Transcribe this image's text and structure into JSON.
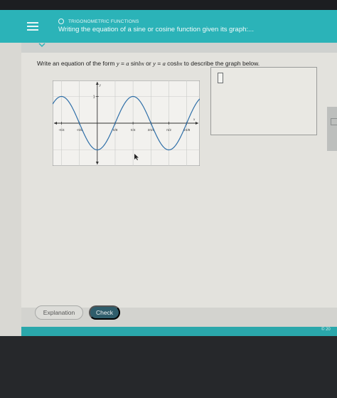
{
  "header": {
    "topic": "TRIGONOMETRIC FUNCTIONS",
    "title": "Writing the equation of a sine or cosine function given its graph:..."
  },
  "prompt": {
    "lead": "Write an equation of the form ",
    "form1_y": "y",
    "form1_eq": " = ",
    "form1_a": "a",
    "form1_fn": " sin",
    "form1_bx": "bx",
    "or": " or ",
    "form2_y": "y",
    "form2_eq": " = ",
    "form2_a": "a",
    "form2_fn": " cos",
    "form2_bx": "bx",
    "tail": " to describe the graph below."
  },
  "chart_data": {
    "type": "line",
    "function": "y = -cos(4x)",
    "xlim": [
      -0.98,
      2.25
    ],
    "ylim": [
      -1.6,
      1.6
    ],
    "grid": true,
    "x_axis_label": "x",
    "y_axis_label": "y",
    "y_tick_label": "1",
    "x_tick_labels": [
      "-π/4",
      "-π/8",
      "π/8",
      "π/4",
      "3π/8",
      "π/2",
      "5π/8",
      "3π/4"
    ],
    "x_tick_values": [
      -0.785,
      -0.393,
      0.393,
      0.785,
      1.178,
      1.571,
      1.963,
      2.356
    ],
    "curve_color": "#2f6fa8"
  },
  "buttons": {
    "explanation": "Explanation",
    "check": "Check"
  },
  "footer": {
    "copyright": "© 20"
  },
  "colors": {
    "header": "#2bb3b8",
    "check_button": "#2f5d6b"
  }
}
